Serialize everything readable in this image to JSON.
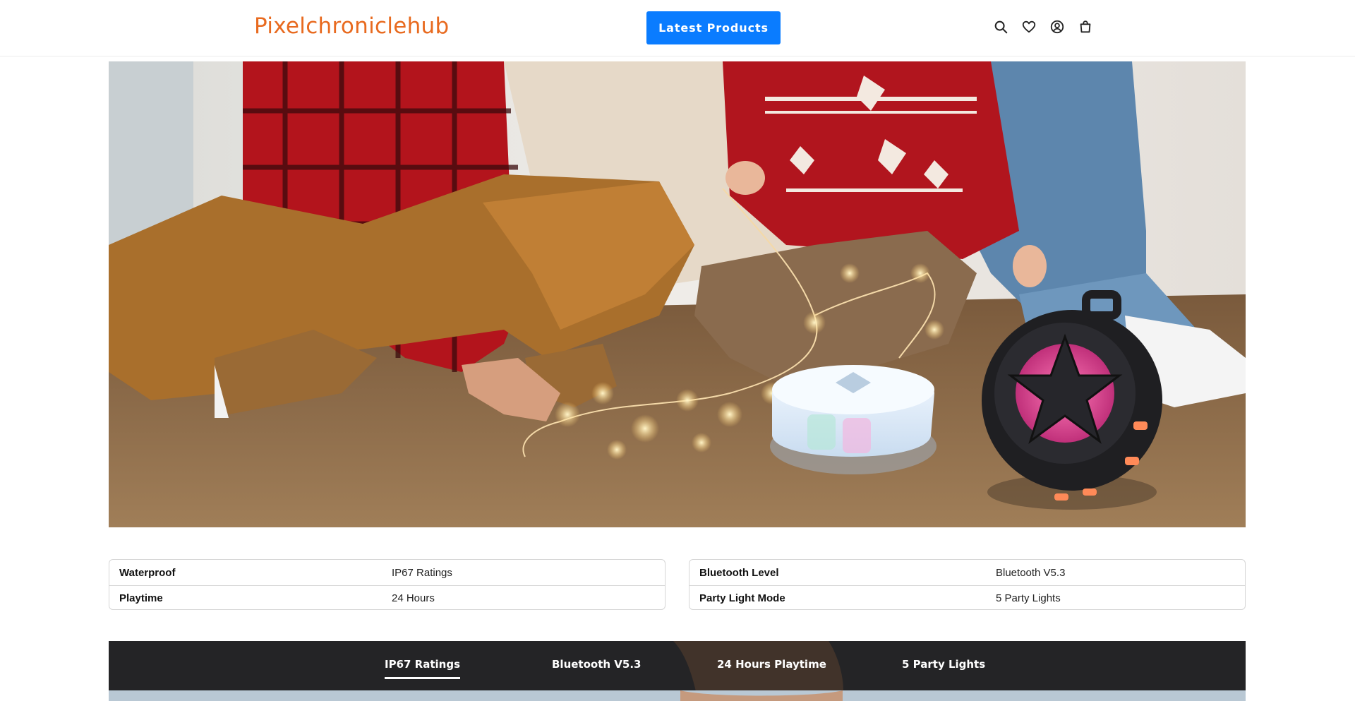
{
  "header": {
    "logo": "Pixelchroniclehub",
    "latest_button": "Latest Products",
    "icons": [
      "search-icon",
      "heart-icon",
      "account-icon",
      "bag-icon"
    ]
  },
  "hero": {
    "description": "lifestyle-banner"
  },
  "specs_left": [
    {
      "label": "Waterproof",
      "value": "IP67 Ratings"
    },
    {
      "label": "Playtime",
      "value": "24 Hours"
    }
  ],
  "specs_right": [
    {
      "label": "Bluetooth Level",
      "value": "Bluetooth V5.3"
    },
    {
      "label": "Party Light Mode",
      "value": "5 Party Lights"
    }
  ],
  "feature_tabs": [
    "IP67 Ratings",
    "Bluetooth V5.3",
    "24 Hours Playtime",
    "5 Party Lights"
  ],
  "colors": {
    "brand": "#e86a1f",
    "accent": "#0a7cff"
  }
}
